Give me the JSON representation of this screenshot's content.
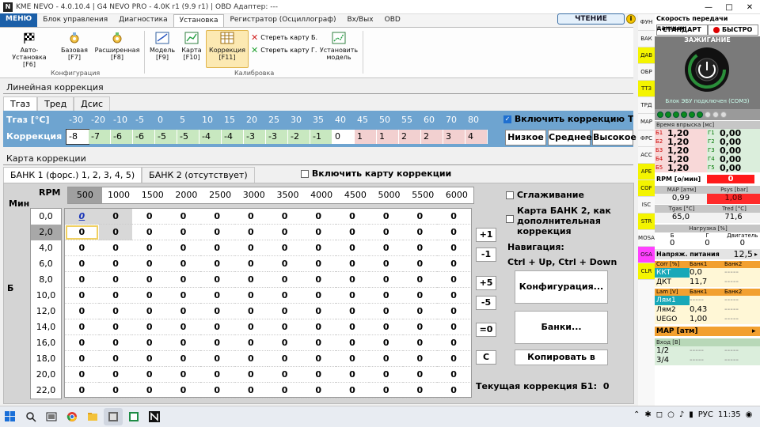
{
  "window": {
    "title": "KME NEVO - 4.0.10.4 | G4 NEVO PRO - 4.0K r1 (9.9 r1) | OBD Адаптер: ---",
    "logo": "N"
  },
  "menu": {
    "items": [
      "МЕНЮ",
      "Блок управления",
      "Диагностика",
      "Установка",
      "Регистратор (Осциллограф)",
      "Вх/Вых",
      "OBD"
    ],
    "status": "ЧТЕНИЕ",
    "warn": "i"
  },
  "ribbon": {
    "auto": {
      "label": "Авто-Установка",
      "key": "[F6]"
    },
    "base": {
      "label": "Базовая",
      "key": "[F7]"
    },
    "ext": {
      "label": "Расширенная",
      "key": "[F8]"
    },
    "model": {
      "label": "Модель",
      "key": "[F9]"
    },
    "map": {
      "label": "Карта",
      "key": "[F10]"
    },
    "corr": {
      "label": "Коррекция",
      "key": "[F11]"
    },
    "eraseB": "Стереть карту Б.",
    "eraseG": "Стереть карту Г.",
    "setmodel": {
      "line1": "Установить",
      "line2": "модель"
    },
    "group1": "Конфигурация",
    "group2": "Калибровка"
  },
  "linear": {
    "title": "Линейная коррекция",
    "tabs": [
      "Tгаз",
      "Tред",
      "Дсис"
    ],
    "row1_label": "Tгаз    [°C]",
    "row2_label": "Коррекция [%]",
    "temps": [
      "-30",
      "-20",
      "-10",
      "-5",
      "0",
      "5",
      "10",
      "15",
      "20",
      "25",
      "30",
      "35",
      "40",
      "45",
      "50",
      "55",
      "60",
      "70",
      "80"
    ],
    "values": [
      "-8",
      "-7",
      "-6",
      "-6",
      "-5",
      "-5",
      "-4",
      "-4",
      "-3",
      "-3",
      "-2",
      "-1",
      "0",
      "1",
      "1",
      "2",
      "2",
      "3",
      "4"
    ],
    "enable": "Включить коррекцию Tr",
    "low": "Низкое",
    "mid": "Среднее",
    "high": "Высокое"
  },
  "mapcorr": {
    "title": "Карта коррекции",
    "bank1": "БАНК 1 (форс.) 1, 2, 3, 4, 5)",
    "bank2": "БАНК 2 (отсутствует)",
    "enable_map": "Включить карту коррекции",
    "rpm_label": "RPM",
    "min_label": "Мин",
    "b_label": "Б",
    "rpm": [
      "500",
      "1000",
      "1500",
      "2000",
      "2500",
      "3000",
      "3500",
      "4000",
      "4500",
      "5000",
      "5500",
      "6000"
    ],
    "loads": [
      "0,0",
      "2,0",
      "4,0",
      "6,0",
      "8,0",
      "10,0",
      "12,0",
      "14,0",
      "16,0",
      "18,0",
      "20,0",
      "22,0"
    ],
    "cell": "0",
    "smoothing": "Сглаживание",
    "bank2map": [
      "Карта БАНК 2, как",
      "дополнительная",
      "коррекция"
    ],
    "nav_title": "Навигация:",
    "nav_keys": "Ctrl + Up, Ctrl + Down",
    "b_plus1": "+1",
    "b_minus1": "-1",
    "b_plus5": "+5",
    "b_minus5": "-5",
    "b_zero": "=0",
    "b_c": "C",
    "config": "Конфигурация...",
    "banks": "Банки...",
    "copy": "Копировать в банк",
    "current_label": "Текущая коррекция Б1:",
    "current_value": "0"
  },
  "side": [
    "ФУН",
    "ВАК",
    "ДАВ",
    "ОБР",
    "ТТЗ",
    "ТРД",
    "МАР",
    "ФРС",
    "АСС",
    "АРЕ",
    "COF",
    "ISC",
    "STR",
    "MOSA",
    "OSA",
    "CLR"
  ],
  "panel": {
    "speed_title": "Скорость передачи данных:",
    "std": "СТАНДАРТ",
    "fast": "БЫСТРО",
    "ignition": "ЗАЖИГАНИЕ",
    "ecu_status": "Блок ЭБУ подключен (COM3)",
    "inj_title": "Время впрыска [мс]",
    "b": [
      {
        "n": "Б1",
        "v": "1,20"
      },
      {
        "n": "Б2",
        "v": "1,20"
      },
      {
        "n": "Б3",
        "v": "1,20"
      },
      {
        "n": "Б4",
        "v": "1,20"
      },
      {
        "n": "Б5",
        "v": "1,20"
      }
    ],
    "g": [
      {
        "n": "Г1",
        "v": "0,00"
      },
      {
        "n": "Г2",
        "v": "0,00"
      },
      {
        "n": "Г3",
        "v": "0,00"
      },
      {
        "n": "Г4",
        "v": "0,00"
      },
      {
        "n": "Г5",
        "v": "0,00"
      }
    ],
    "rpm_label": "RPM [о/мин]",
    "rpm": "0",
    "map_label": "MAP [атм]",
    "map": "0,99",
    "psys_label": "Psys [bar]",
    "psys": "1,08",
    "tgas_label": "Tgas [°C]",
    "tgas": "65,0",
    "tred_label": "Tred [°C]",
    "tred": "71,6",
    "load_label": "Нагрузка [%]",
    "load_b": "Б",
    "load_g": "Г",
    "load_e": "Двигатель",
    "load_vals": [
      "0",
      "0",
      "0"
    ],
    "volt_label": "Напряж. питания",
    "volt": "12,5",
    "corr_hdr": [
      "Corr [%]",
      "Банк1",
      "Банк2"
    ],
    "kkt": "ККТ",
    "kkt_v": "0,0",
    "dkt": "ДКТ",
    "dkt_v": "11,7",
    "dash": "-----",
    "lam_hdr": [
      "Lam [V]",
      "Банк1",
      "Банк2"
    ],
    "lam1": "Лям1",
    "lam2": "Лям2",
    "lam2_v": "0,43",
    "uego": "UEGO",
    "uego_v": "1,00",
    "mapatm": "МАР [атм]",
    "in_hdr": "Вход [В]",
    "in1": "1/2",
    "in2": "3/4"
  },
  "tray": {
    "lang": "РУС",
    "time": "11:35"
  }
}
